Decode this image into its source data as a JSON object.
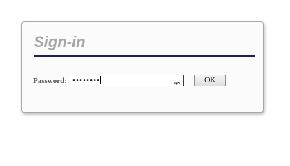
{
  "signin": {
    "title": "Sign-in",
    "password_label": "Password:",
    "password_value": "••••••••",
    "ok_label": "OK"
  },
  "icons": {
    "reveal": "eye-icon"
  },
  "colors": {
    "title": "#a6a6a6",
    "rule": "#1f1f55",
    "label": "#555555"
  }
}
